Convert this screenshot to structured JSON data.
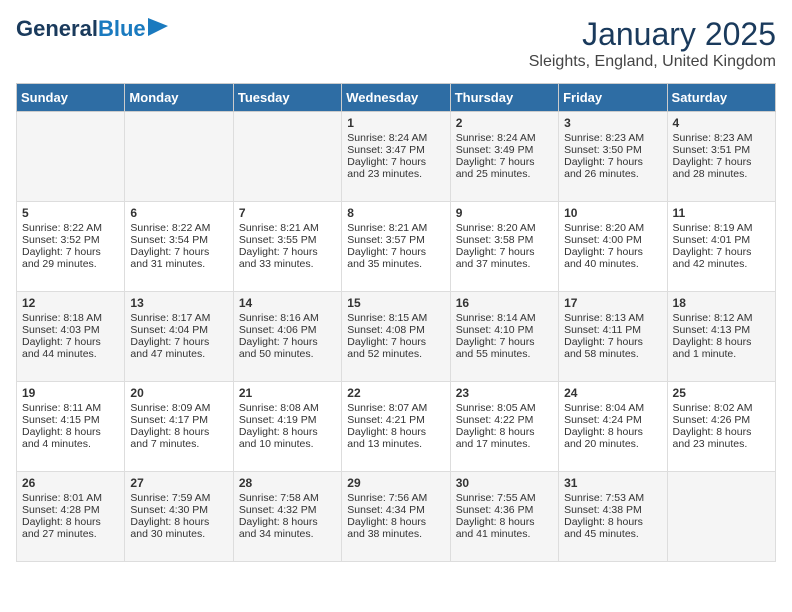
{
  "header": {
    "logo_general": "General",
    "logo_blue": "Blue",
    "month_title": "January 2025",
    "location": "Sleights, England, United Kingdom"
  },
  "weekdays": [
    "Sunday",
    "Monday",
    "Tuesday",
    "Wednesday",
    "Thursday",
    "Friday",
    "Saturday"
  ],
  "weeks": [
    [
      {
        "day": "",
        "sunrise": "",
        "sunset": "",
        "daylight": ""
      },
      {
        "day": "",
        "sunrise": "",
        "sunset": "",
        "daylight": ""
      },
      {
        "day": "",
        "sunrise": "",
        "sunset": "",
        "daylight": ""
      },
      {
        "day": "1",
        "sunrise": "Sunrise: 8:24 AM",
        "sunset": "Sunset: 3:47 PM",
        "daylight": "Daylight: 7 hours and 23 minutes."
      },
      {
        "day": "2",
        "sunrise": "Sunrise: 8:24 AM",
        "sunset": "Sunset: 3:49 PM",
        "daylight": "Daylight: 7 hours and 25 minutes."
      },
      {
        "day": "3",
        "sunrise": "Sunrise: 8:23 AM",
        "sunset": "Sunset: 3:50 PM",
        "daylight": "Daylight: 7 hours and 26 minutes."
      },
      {
        "day": "4",
        "sunrise": "Sunrise: 8:23 AM",
        "sunset": "Sunset: 3:51 PM",
        "daylight": "Daylight: 7 hours and 28 minutes."
      }
    ],
    [
      {
        "day": "5",
        "sunrise": "Sunrise: 8:22 AM",
        "sunset": "Sunset: 3:52 PM",
        "daylight": "Daylight: 7 hours and 29 minutes."
      },
      {
        "day": "6",
        "sunrise": "Sunrise: 8:22 AM",
        "sunset": "Sunset: 3:54 PM",
        "daylight": "Daylight: 7 hours and 31 minutes."
      },
      {
        "day": "7",
        "sunrise": "Sunrise: 8:21 AM",
        "sunset": "Sunset: 3:55 PM",
        "daylight": "Daylight: 7 hours and 33 minutes."
      },
      {
        "day": "8",
        "sunrise": "Sunrise: 8:21 AM",
        "sunset": "Sunset: 3:57 PM",
        "daylight": "Daylight: 7 hours and 35 minutes."
      },
      {
        "day": "9",
        "sunrise": "Sunrise: 8:20 AM",
        "sunset": "Sunset: 3:58 PM",
        "daylight": "Daylight: 7 hours and 37 minutes."
      },
      {
        "day": "10",
        "sunrise": "Sunrise: 8:20 AM",
        "sunset": "Sunset: 4:00 PM",
        "daylight": "Daylight: 7 hours and 40 minutes."
      },
      {
        "day": "11",
        "sunrise": "Sunrise: 8:19 AM",
        "sunset": "Sunset: 4:01 PM",
        "daylight": "Daylight: 7 hours and 42 minutes."
      }
    ],
    [
      {
        "day": "12",
        "sunrise": "Sunrise: 8:18 AM",
        "sunset": "Sunset: 4:03 PM",
        "daylight": "Daylight: 7 hours and 44 minutes."
      },
      {
        "day": "13",
        "sunrise": "Sunrise: 8:17 AM",
        "sunset": "Sunset: 4:04 PM",
        "daylight": "Daylight: 7 hours and 47 minutes."
      },
      {
        "day": "14",
        "sunrise": "Sunrise: 8:16 AM",
        "sunset": "Sunset: 4:06 PM",
        "daylight": "Daylight: 7 hours and 50 minutes."
      },
      {
        "day": "15",
        "sunrise": "Sunrise: 8:15 AM",
        "sunset": "Sunset: 4:08 PM",
        "daylight": "Daylight: 7 hours and 52 minutes."
      },
      {
        "day": "16",
        "sunrise": "Sunrise: 8:14 AM",
        "sunset": "Sunset: 4:10 PM",
        "daylight": "Daylight: 7 hours and 55 minutes."
      },
      {
        "day": "17",
        "sunrise": "Sunrise: 8:13 AM",
        "sunset": "Sunset: 4:11 PM",
        "daylight": "Daylight: 7 hours and 58 minutes."
      },
      {
        "day": "18",
        "sunrise": "Sunrise: 8:12 AM",
        "sunset": "Sunset: 4:13 PM",
        "daylight": "Daylight: 8 hours and 1 minute."
      }
    ],
    [
      {
        "day": "19",
        "sunrise": "Sunrise: 8:11 AM",
        "sunset": "Sunset: 4:15 PM",
        "daylight": "Daylight: 8 hours and 4 minutes."
      },
      {
        "day": "20",
        "sunrise": "Sunrise: 8:09 AM",
        "sunset": "Sunset: 4:17 PM",
        "daylight": "Daylight: 8 hours and 7 minutes."
      },
      {
        "day": "21",
        "sunrise": "Sunrise: 8:08 AM",
        "sunset": "Sunset: 4:19 PM",
        "daylight": "Daylight: 8 hours and 10 minutes."
      },
      {
        "day": "22",
        "sunrise": "Sunrise: 8:07 AM",
        "sunset": "Sunset: 4:21 PM",
        "daylight": "Daylight: 8 hours and 13 minutes."
      },
      {
        "day": "23",
        "sunrise": "Sunrise: 8:05 AM",
        "sunset": "Sunset: 4:22 PM",
        "daylight": "Daylight: 8 hours and 17 minutes."
      },
      {
        "day": "24",
        "sunrise": "Sunrise: 8:04 AM",
        "sunset": "Sunset: 4:24 PM",
        "daylight": "Daylight: 8 hours and 20 minutes."
      },
      {
        "day": "25",
        "sunrise": "Sunrise: 8:02 AM",
        "sunset": "Sunset: 4:26 PM",
        "daylight": "Daylight: 8 hours and 23 minutes."
      }
    ],
    [
      {
        "day": "26",
        "sunrise": "Sunrise: 8:01 AM",
        "sunset": "Sunset: 4:28 PM",
        "daylight": "Daylight: 8 hours and 27 minutes."
      },
      {
        "day": "27",
        "sunrise": "Sunrise: 7:59 AM",
        "sunset": "Sunset: 4:30 PM",
        "daylight": "Daylight: 8 hours and 30 minutes."
      },
      {
        "day": "28",
        "sunrise": "Sunrise: 7:58 AM",
        "sunset": "Sunset: 4:32 PM",
        "daylight": "Daylight: 8 hours and 34 minutes."
      },
      {
        "day": "29",
        "sunrise": "Sunrise: 7:56 AM",
        "sunset": "Sunset: 4:34 PM",
        "daylight": "Daylight: 8 hours and 38 minutes."
      },
      {
        "day": "30",
        "sunrise": "Sunrise: 7:55 AM",
        "sunset": "Sunset: 4:36 PM",
        "daylight": "Daylight: 8 hours and 41 minutes."
      },
      {
        "day": "31",
        "sunrise": "Sunrise: 7:53 AM",
        "sunset": "Sunset: 4:38 PM",
        "daylight": "Daylight: 8 hours and 45 minutes."
      },
      {
        "day": "",
        "sunrise": "",
        "sunset": "",
        "daylight": ""
      }
    ]
  ]
}
